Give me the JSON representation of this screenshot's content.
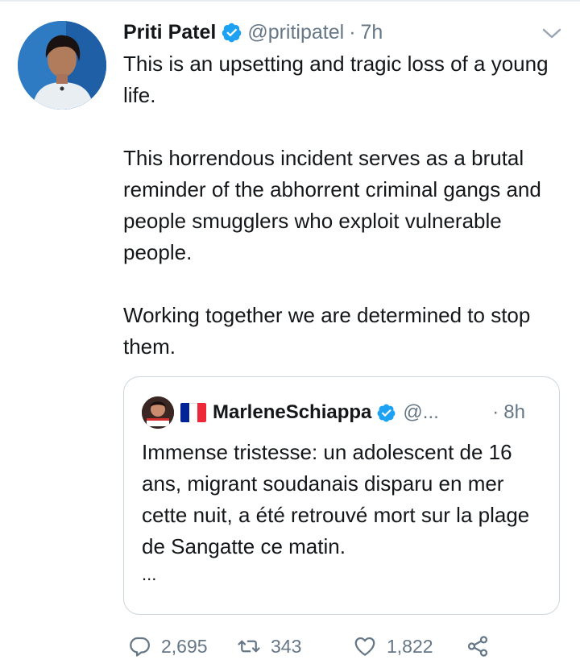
{
  "tweet": {
    "author_name": "Priti Patel",
    "author_handle": "@pritipatel",
    "separator": "·",
    "time": "7h",
    "paragraphs": [
      "This is an upsetting and tragic loss of a young life.",
      "This horrendous incident serves as a brutal reminder of the abhorrent criminal gangs and people smugglers who exploit vulnerable people.",
      "Working together we are determined to stop them."
    ]
  },
  "quoted_tweet": {
    "author_name": "MarleneSchiappa",
    "author_handle": "@...",
    "separator": "·",
    "time": "8h",
    "text": "Immense tristesse: un adolescent de 16 ans, migrant soudanais disparu en mer cette nuit, a été retrouvé mort sur la plage de Sangatte ce matin.",
    "more": "..."
  },
  "actions": {
    "reply_count": "2,695",
    "retweet_count": "343",
    "like_count": "1,822"
  },
  "colors": {
    "accent": "#1da1f2",
    "secondary_text": "#657786",
    "border": "#ccd6dd",
    "flag": [
      "#002395",
      "#ffffff",
      "#ed2939"
    ]
  },
  "icons": [
    "verified-badge-icon",
    "chevron-down-icon",
    "french-flag-icon",
    "reply-icon",
    "retweet-icon",
    "like-icon",
    "share-icon"
  ]
}
